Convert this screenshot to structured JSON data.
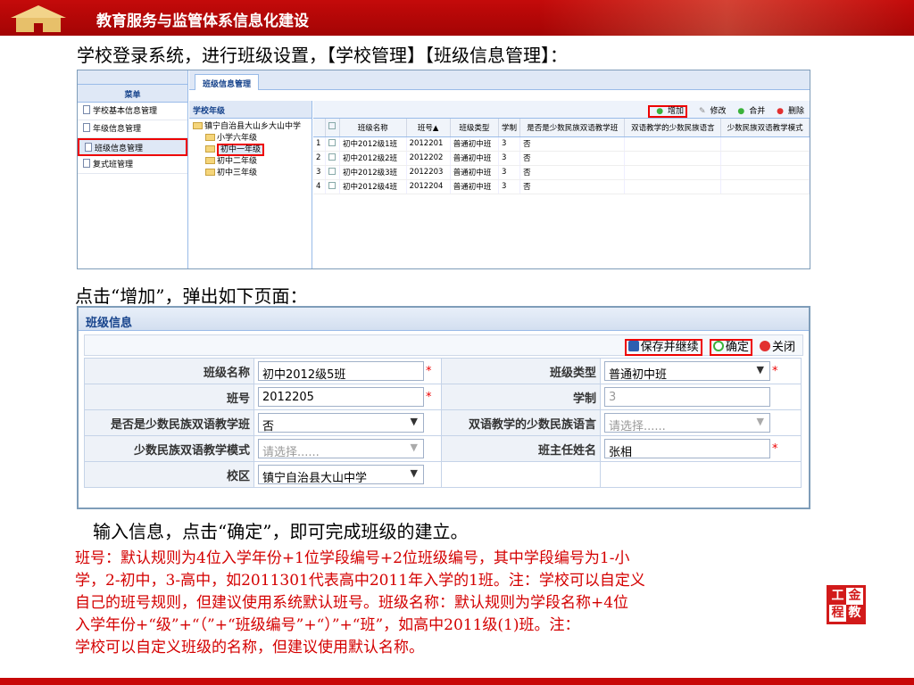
{
  "header": {
    "title": "教育服务与监管体系信息化建设"
  },
  "line1": "学校登录系统，进行班级设置，【学校管理】【班级信息管理】：",
  "shot1": {
    "tab": "班级信息管理",
    "menu_title": "菜单",
    "menu": [
      "学校基本信息管理",
      "年级信息管理",
      "班级信息管理",
      "复式班管理"
    ],
    "tree_title": "学校年级",
    "tree": [
      "镇宁自治县大山乡大山中学",
      "小学六年级",
      "初中一年级",
      "初中二年级",
      "初中三年级"
    ],
    "toolbar": [
      "增加",
      "修改",
      "合并",
      "删除"
    ],
    "columns": [
      "",
      "",
      "班级名称",
      "班号▲",
      "班级类型",
      "学制",
      "是否是少数民族双语教学班",
      "双语教学的少数民族语言",
      "少数民族双语教学模式"
    ],
    "rows": [
      [
        "1",
        "初中2012级1班",
        "2012201",
        "普通初中班",
        "3",
        "否"
      ],
      [
        "2",
        "初中2012级2班",
        "2012202",
        "普通初中班",
        "3",
        "否"
      ],
      [
        "3",
        "初中2012级3班",
        "2012203",
        "普通初中班",
        "3",
        "否"
      ],
      [
        "4",
        "初中2012级4班",
        "2012204",
        "普通初中班",
        "3",
        "否"
      ]
    ]
  },
  "line2": "点击“增加”，弹出如下页面：",
  "form": {
    "title": "班级信息",
    "buttons": {
      "save": "保存并继续",
      "ok": "确定",
      "close": "关闭"
    },
    "labels": {
      "name": "班级名称",
      "type": "班级类型",
      "code": "班号",
      "years": "学制",
      "bilingual": "是否是少数民族双语教学班",
      "language": "双语教学的少数民族语言",
      "mode": "少数民族双语教学模式",
      "teacher": "班主任姓名",
      "campus": "校区"
    },
    "values": {
      "name": "初中2012级5班",
      "type": "普通初中班",
      "code": "2012205",
      "years": "3",
      "bilingual": "否",
      "language": "请选择......",
      "mode": "请选择......",
      "teacher": "张相",
      "campus": "镇宁自治县大山中学"
    }
  },
  "line3": "输入信息，点击“确定”，即可完成班级的建立。",
  "note": [
    "班号：默认规则为4位入学年份+1位学段编号+2位班级编号，其中学段编号为1-小",
    "学，2-初中，3-高中，如2011301代表高中2011年入学的1班。注：学校可以自定义",
    "自己的班号规则，但建议使用系统默认班号。班级名称：默认规则为学段名称+4位",
    "入学年份+“级”+“（”+“班级编号”+“）”+“班”，如高中2011级(1)班。注：",
    "学校可以自定义班级的名称，但建议使用默认名称。"
  ],
  "seal": [
    "工",
    "金",
    "程",
    "教"
  ]
}
